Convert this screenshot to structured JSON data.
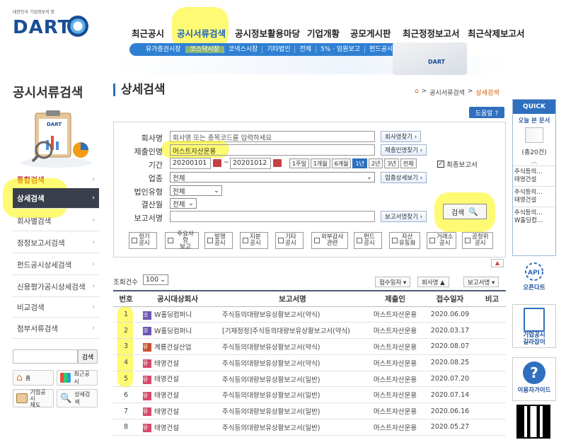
{
  "header": {
    "logo_small": "대한민국 기업정보의 창",
    "logo": "DART",
    "banner_logo": "DART",
    "nav": [
      "최근공시",
      "공시서류검색",
      "공시정보활용마당",
      "기업개황",
      "공모게시판",
      "최근정정보고서",
      "최근삭제보고서"
    ],
    "subnav": [
      "유가증권시장",
      "코스닥시장",
      "코넥스시장",
      "기타법인",
      "전체",
      "5% · 임원보고",
      "펀드공시"
    ]
  },
  "sidebar": {
    "title": "공시서류검색",
    "illustration_label": "DART",
    "items": [
      {
        "label": "통합검색",
        "state": "red"
      },
      {
        "label": "상세검색",
        "state": "selected"
      },
      {
        "label": "회사별검색",
        "state": ""
      },
      {
        "label": "정정보고서검색",
        "state": ""
      },
      {
        "label": "펀드공시상세검색",
        "state": ""
      },
      {
        "label": "신용평가공시상세검색",
        "state": ""
      },
      {
        "label": "비교검색",
        "state": ""
      },
      {
        "label": "첨부서류검색",
        "state": ""
      }
    ],
    "search_button": "검색",
    "shortcuts": [
      {
        "label": "홈"
      },
      {
        "label": "최근공시"
      },
      {
        "label": "기업공시\n제도"
      },
      {
        "label": "상세검색"
      }
    ]
  },
  "main": {
    "title": "상세검색",
    "breadcrumb": [
      "공시서류검색",
      "상세검색"
    ],
    "breadcrumb_separator": ">",
    "help_button": "도움말 ?",
    "form": {
      "company_label": "회사명",
      "company_placeholder": "회사명 또는 종목코드를 입력하세요",
      "company_button": "회사명찾기 ›",
      "submitter_label": "제출인명",
      "submitter_value": "머스트자산운용",
      "submitter_button": "제출인명찾기 ›",
      "period_label": "기간",
      "period_from": "20200101",
      "period_to": "20201012",
      "period_sep": "~",
      "period_buttons": [
        "1주일",
        "1개월",
        "6개월",
        "1년",
        "2년",
        "3년",
        "전체"
      ],
      "period_active": "1년",
      "final_report_label": "최종보고서",
      "industry_label": "업종",
      "industry_value": "전체",
      "industry_button": "업종상세보기 ›",
      "corp_type_label": "법인유형",
      "corp_type_value": "전체",
      "fiscal_label": "결산월",
      "fiscal_value": "전체",
      "report_label": "보고서명",
      "report_button": "보고서명찾기 ›",
      "search_button": "검색",
      "categories": [
        "정기\n공시",
        "주요사항\n보고",
        "발행\n공시",
        "지분\n공시",
        "기타\n공시",
        "외부감사\n관련",
        "펀드\n공시",
        "자산\n유동화",
        "거래소\n공시",
        "공정위\n공시"
      ]
    },
    "results": {
      "count_label": "조회건수",
      "count_value": "100",
      "collapse": "▲",
      "sort_buttons": [
        {
          "label": "접수일자 ▾"
        },
        {
          "label": "회사명 ▲"
        },
        {
          "label": "보고서명 ▾"
        }
      ],
      "columns": [
        "번호",
        "공시대상회사",
        "보고서명",
        "제출인",
        "접수일자",
        "비고"
      ],
      "rows": [
        {
          "no": "1",
          "market": "코",
          "company": "W홀딩컴퍼니",
          "report": "주식등의대량보유상황보고서(약식)",
          "style": "pink",
          "submitter": "머스트자산운용",
          "date": "2020.06.09",
          "note": ""
        },
        {
          "no": "2",
          "market": "코",
          "company": "W홀딩컴퍼니",
          "report": "[기재정정]주식등의대량보유상황보고서(약식)",
          "style": "blue",
          "submitter": "머스트자산운용",
          "date": "2020.03.17",
          "note": ""
        },
        {
          "no": "3",
          "market": "유",
          "company": "계룡건설산업",
          "report": "주식등의대량보유상황보고서(약식)",
          "style": "pink",
          "submitter": "머스트자산운용",
          "date": "2020.08.07",
          "note": ""
        },
        {
          "no": "4",
          "market": "유",
          "company": "태영건설",
          "report": "주식등의대량보유상황보고서(약식)",
          "style": "pink",
          "submitter": "머스트자산운용",
          "date": "2020.08.25",
          "note": ""
        },
        {
          "no": "5",
          "market": "유",
          "company": "태영건설",
          "report": "주식등의대량보유상황보고서(일반)",
          "style": "norm",
          "submitter": "머스트자산운용",
          "date": "2020.07.20",
          "note": ""
        },
        {
          "no": "6",
          "market": "유",
          "company": "태영건설",
          "report": "주식등의대량보유상황보고서(일반)",
          "style": "norm",
          "submitter": "머스트자산운용",
          "date": "2020.07.14",
          "note": ""
        },
        {
          "no": "7",
          "market": "유",
          "company": "태영건설",
          "report": "주식등의대량보유상황보고서(일반)",
          "style": "norm",
          "submitter": "머스트자산운용",
          "date": "2020.06.16",
          "note": ""
        },
        {
          "no": "8",
          "market": "유",
          "company": "태영건설",
          "report": "주식등의대량보유상황보고서(일반)",
          "style": "norm",
          "submitter": "머스트자산운용",
          "date": "2020.05.27",
          "note": ""
        }
      ]
    }
  },
  "quick": {
    "title": "QUICK",
    "subtitle": "오늘 본 문서",
    "count": "(총20건)",
    "items": [
      "주식등의…\n태영건설",
      "주식등의…\n태영건설",
      "주식등의…\nW홀딩컴…"
    ],
    "blocks": [
      {
        "label": "오픈다트"
      },
      {
        "label": "기업공시\n길라잡이"
      },
      {
        "label": "이용자가이드"
      }
    ]
  },
  "colors": {
    "brand": "#1a4d96",
    "accent": "#2f6fbf",
    "highlight": "#fff500",
    "sidebar_selected": "#3a3f4c"
  }
}
